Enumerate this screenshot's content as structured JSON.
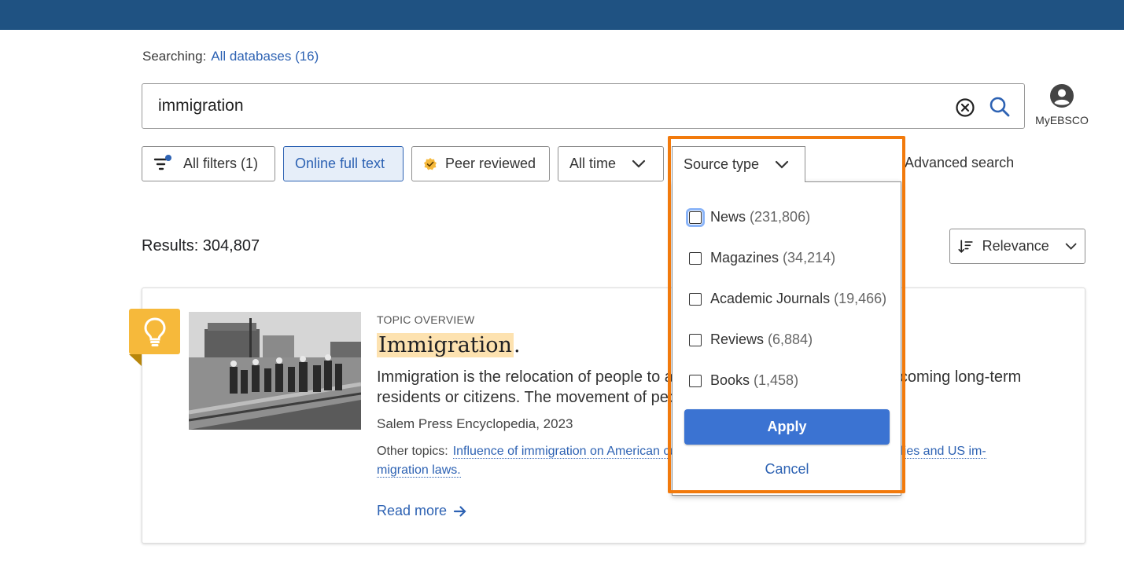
{
  "header": {
    "bar_color": "#1f5282"
  },
  "searching": {
    "label": "Searching:",
    "databases": "All databases (16)"
  },
  "search": {
    "query": "immigration"
  },
  "account": {
    "label": "MyEBSCO"
  },
  "filters": {
    "all_filters": "All filters (1)",
    "online_full_text": "Online full text",
    "peer_reviewed": "Peer reviewed",
    "all_time": "All time",
    "source_type": "Source type",
    "advanced_search": "Advanced search"
  },
  "results": {
    "count_label": "Results: 304,807",
    "sort": "Relevance"
  },
  "result_card": {
    "type": "TOPIC OVERVIEW",
    "title": "Immigration",
    "title_suffix": ".",
    "description": "Immigration is the relocation of people to a new country with the hope of becoming long-term residents or citizens. The movement of people between lands has been a...",
    "source": "Salem Press Encyclopedia, 2023",
    "other_topics_label": "Other topics:",
    "topic1": "Influence of immigration on American culture",
    "topic2_start": "Immigrant families and US im-",
    "topic2_end": "migration laws.",
    "read_more": "Read more"
  },
  "source_type_menu": {
    "options": [
      {
        "label": "News",
        "count": "(231,806)",
        "checked": false
      },
      {
        "label": "Magazines",
        "count": "(34,214)",
        "checked": false
      },
      {
        "label": "Academic Journals",
        "count": "(19,466)",
        "checked": false
      },
      {
        "label": "Reviews",
        "count": "(6,884)",
        "checked": false
      },
      {
        "label": "Books",
        "count": "(1,458)",
        "checked": false
      }
    ],
    "apply": "Apply",
    "cancel": "Cancel",
    "highlight_color": "#f27a0c"
  },
  "colors": {
    "link": "#2d62b3",
    "apply_button": "#3b73d2",
    "badge": "#f6b93b"
  }
}
